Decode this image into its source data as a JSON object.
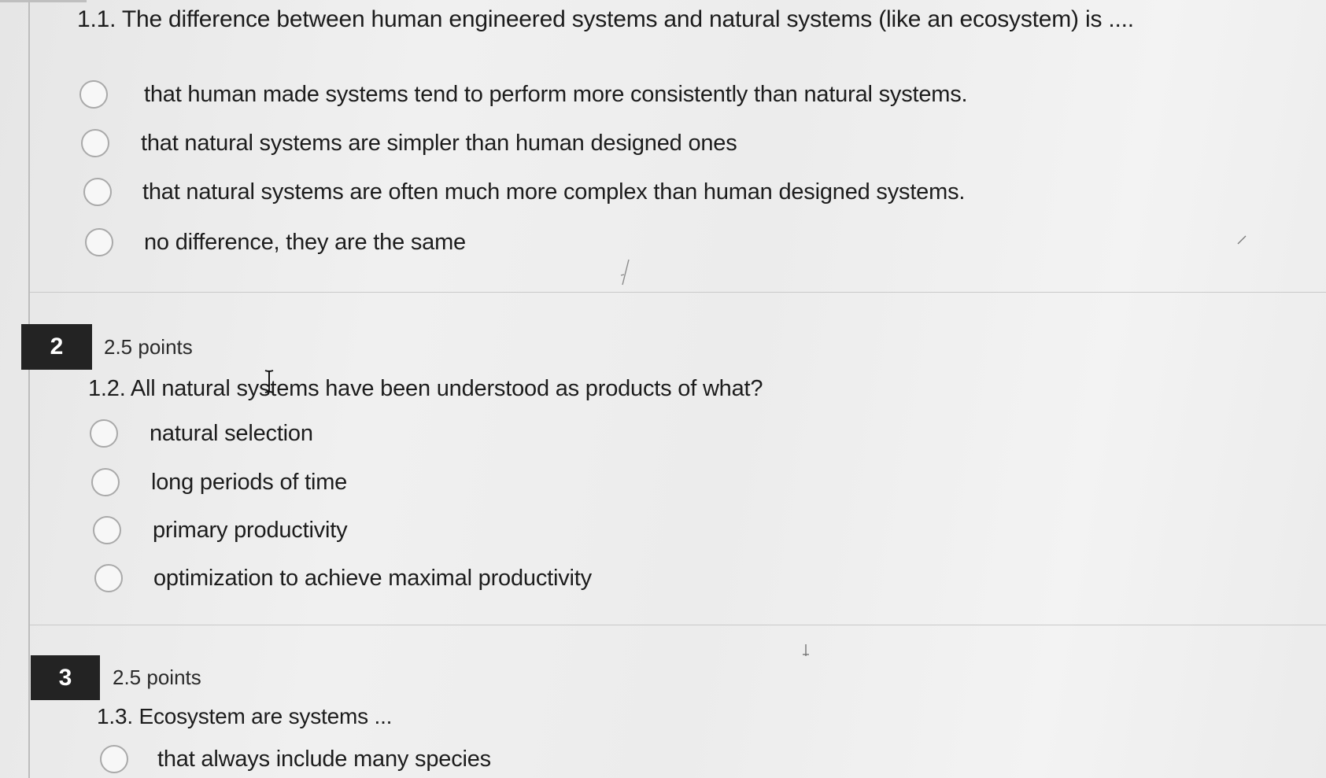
{
  "questions": [
    {
      "number": "",
      "points": "",
      "text": "1.1. The difference between human engineered systems and natural systems (like an ecosystem) is ....",
      "options": [
        "that human made systems tend to perform more consistently than natural systems.",
        "that natural systems are simpler than human designed ones",
        "that natural systems are often much more complex than human designed systems.",
        "no difference, they are the same"
      ]
    },
    {
      "number": "2",
      "points": "2.5 points",
      "text": "1.2. All natural systems have been understood as products of what?",
      "options": [
        "natural selection",
        "long periods of time",
        "primary productivity",
        "optimization to achieve maximal productivity"
      ]
    },
    {
      "number": "3",
      "points": "2.5 points",
      "text": "1.3. Ecosystem are systems ...",
      "options": [
        "that always include many species"
      ]
    }
  ]
}
